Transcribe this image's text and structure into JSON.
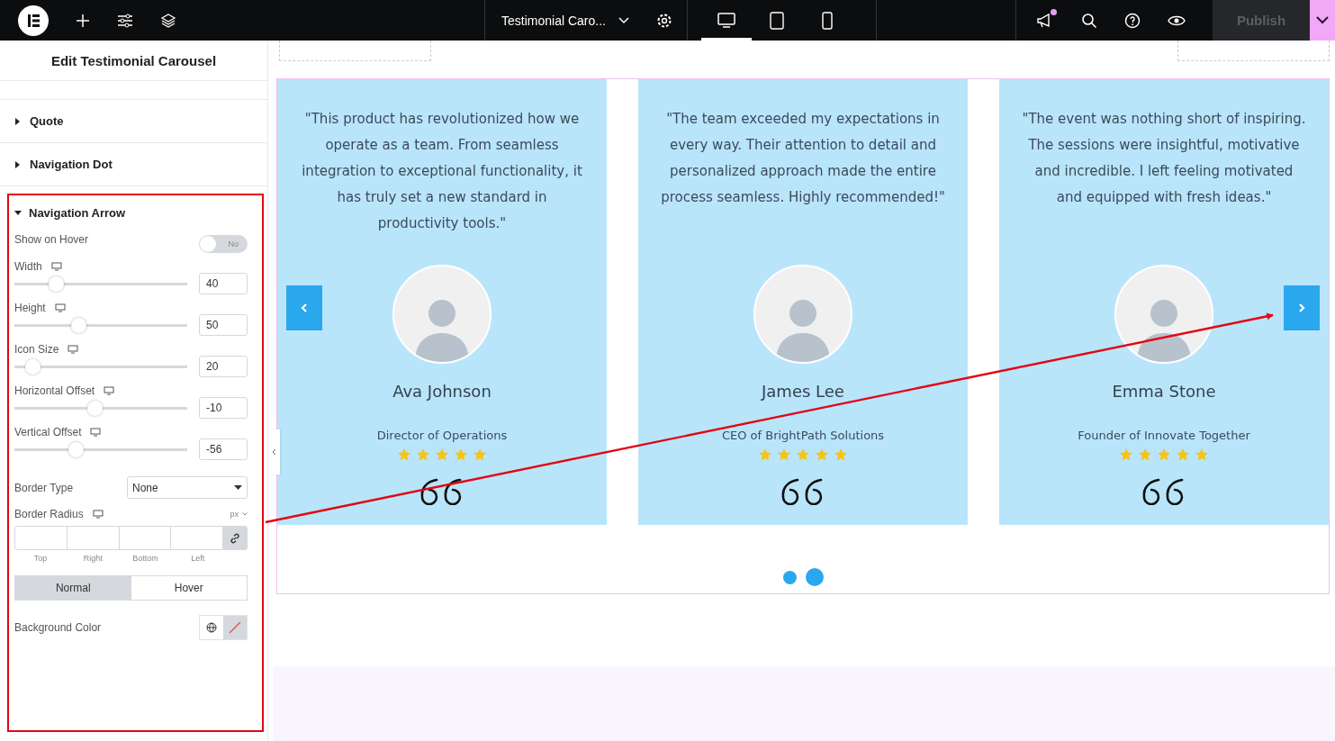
{
  "top_bar": {
    "document_title": "Testimonial Caro...",
    "devices": [
      {
        "kind": "desktop",
        "selected": true
      },
      {
        "kind": "tablet",
        "selected": false
      },
      {
        "kind": "mobile",
        "selected": false
      }
    ],
    "notification": true,
    "publish": {
      "label": "Publish",
      "disabled": true
    }
  },
  "panel": {
    "title": "Edit Testimonial Carousel",
    "sections": [
      {
        "label": "Quote",
        "expanded": false
      },
      {
        "label": "Navigation Dot",
        "expanded": false
      }
    ],
    "active_section": {
      "label": "Navigation Arrow",
      "expanded": true,
      "toggle": {
        "label": "Show on Hover",
        "on": false,
        "state_text": "No"
      },
      "sliders": [
        {
          "label": "Width",
          "level": 0.245,
          "value": "40"
        },
        {
          "label": "Height",
          "level": 0.375,
          "value": "50"
        },
        {
          "label": "Icon Size",
          "level": 0.11,
          "value": "20"
        },
        {
          "label": "Horizontal Offset",
          "level": 0.47,
          "value": "-10"
        },
        {
          "label": "Vertical Offset",
          "level": 0.36,
          "value": "-56"
        }
      ],
      "border_type": {
        "label": "Border Type",
        "value": "None"
      },
      "border_radius": {
        "label": "Border Radius",
        "unit": "px",
        "sides": [
          "Top",
          "Right",
          "Bottom",
          "Left"
        ]
      },
      "state_tabs": [
        {
          "label": "Normal",
          "selected": true
        },
        {
          "label": "Hover",
          "selected": false
        }
      ],
      "background_color": {
        "label": "Background Color"
      }
    }
  },
  "carousel": {
    "cards": [
      {
        "quote": "\"This product has revolutionized how we operate as a team. From seamless integration to exceptional functionality, it has truly set a new standard in productivity tools.\"",
        "name": "Ava Johnson",
        "role": "Director of Operations",
        "stars": 5
      },
      {
        "quote": "\"The team exceeded my expectations in every way. Their attention to detail and personalized approach made the entire process seamless. Highly recommended!\"",
        "name": "James Lee",
        "role": "CEO of BrightPath Solutions",
        "stars": 5
      },
      {
        "quote": "\"The event was nothing short of inspiring. The sessions were insightful, motivative and incredible. I left feeling motivated and equipped with fresh ideas.\"",
        "name": "Emma Stone",
        "role": "Founder of Innovate Together",
        "stars": 5
      }
    ],
    "dots": [
      {
        "selected": false
      },
      {
        "selected": true
      }
    ]
  }
}
